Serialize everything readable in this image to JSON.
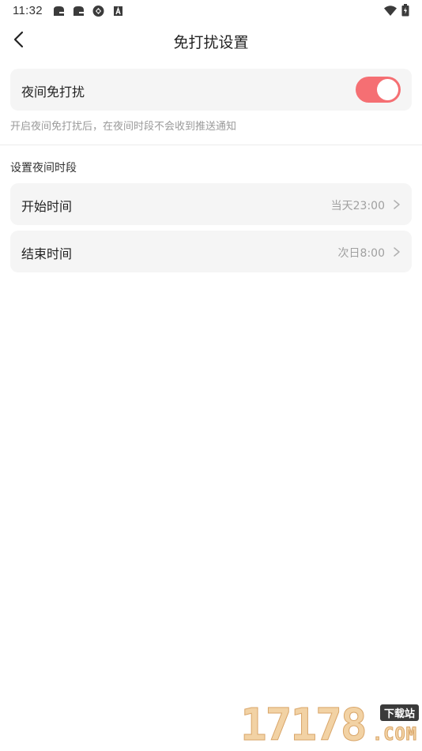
{
  "status_bar": {
    "time": "11:32",
    "notification_icons": [
      "notification-app-icon",
      "notification-app-icon",
      "notification-sync-icon",
      "notification-a-icon"
    ],
    "right_icons": [
      "wifi-icon",
      "battery-icon"
    ]
  },
  "header": {
    "title": "免打扰设置",
    "back_icon": "chevron-left-icon"
  },
  "night_mode": {
    "label": "夜间免打扰",
    "enabled": true,
    "hint": "开启夜间免打扰后，在夜间时段不会收到推送通知"
  },
  "period": {
    "section_title": "设置夜间时段",
    "rows": [
      {
        "label": "开始时间",
        "value": "当天23:00"
      },
      {
        "label": "结束时间",
        "value": "次日8:00"
      }
    ]
  },
  "watermark": {
    "number": "17178",
    "badge": "下载站",
    "domain": ".COM"
  },
  "colors": {
    "toggle_on": "#f56f73",
    "card_bg": "#f5f5f5",
    "hint_text": "#9a9a9a"
  }
}
